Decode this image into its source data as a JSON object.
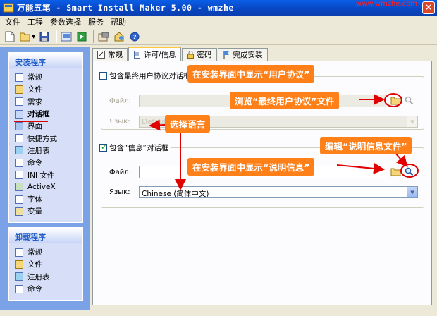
{
  "window": {
    "title": "万能五笔 - Smart Install Maker 5.00 - wmzhe",
    "watermark": "www.wmzhe.com",
    "close": "×"
  },
  "menu": [
    "文件",
    "工程",
    "参数选择",
    "服务",
    "帮助"
  ],
  "toolbar": [
    "new-icon",
    "open-icon",
    "save-icon",
    "build-icon",
    "run-icon",
    "options-icon",
    "web-icon",
    "help-icon"
  ],
  "sidebar": {
    "install_title": "安装程序",
    "install_items": [
      "常规",
      "文件",
      "需求",
      "对话框",
      "界面",
      "快捷方式",
      "注册表",
      "命令",
      "INI 文件",
      "ActiveX",
      "字体",
      "变量"
    ],
    "active_index": 3,
    "uninstall_title": "卸载程序",
    "uninstall_items": [
      "常规",
      "文件",
      "注册表",
      "命令"
    ]
  },
  "tabs": [
    "常规",
    "许可/信息",
    "密码",
    "完成安装"
  ],
  "active_tab": 1,
  "license": {
    "checkbox": "包含最终用户协议对话框",
    "checked": false,
    "file_label": "Файл:",
    "file_value": "",
    "lang_label": "Язык:",
    "lang_value": "Default"
  },
  "info": {
    "checkbox": "包含“信息”对话框",
    "checked": true,
    "file_label": "Файл:",
    "file_value": "",
    "lang_label": "Язык:",
    "lang_value": "Chinese (简体中文)"
  },
  "annotations": {
    "show_license": "在安装界面中显示“用户协议”",
    "browse_license": "浏览“最终用户协议”文件",
    "choose_lang": "选择语言",
    "edit_info": "编辑“说明信息文件”",
    "show_info": "在安装界面中显示“说明信息”"
  },
  "colors": {
    "title_bar": "#0a5ee6",
    "sidebar": "#7ba2e7",
    "annotation": "#ff7f19",
    "highlight": "#e00000"
  }
}
